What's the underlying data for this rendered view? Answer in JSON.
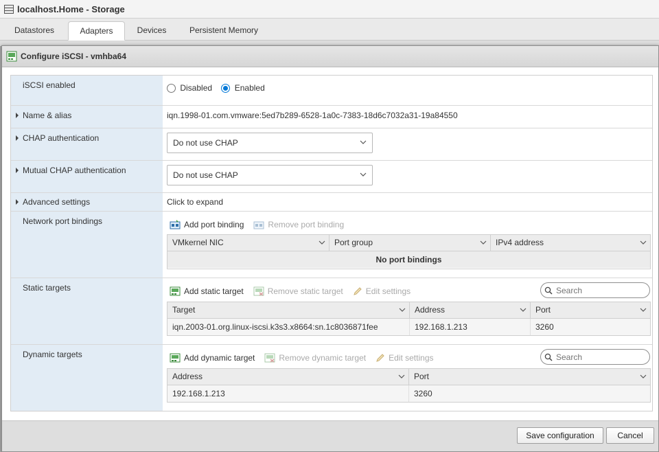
{
  "app": {
    "title": "localhost.Home - Storage"
  },
  "tabs": [
    {
      "label": "Datastores"
    },
    {
      "label": "Adapters",
      "active": true
    },
    {
      "label": "Devices"
    },
    {
      "label": "Persistent Memory"
    }
  ],
  "dialog": {
    "title": "Configure iSCSI - vmhba64",
    "iscsi_enabled": {
      "label": "iSCSI enabled",
      "options": [
        "Disabled",
        "Enabled"
      ],
      "selected": "Enabled"
    },
    "name_alias": {
      "label": "Name & alias",
      "value": "iqn.1998-01.com.vmware:5ed7b289-6528-1a0c-7383-18d6c7032a31-19a84550"
    },
    "chap": {
      "label": "CHAP authentication",
      "value": "Do not use CHAP"
    },
    "mutual_chap": {
      "label": "Mutual CHAP authentication",
      "value": "Do not use CHAP"
    },
    "advanced": {
      "label": "Advanced settings",
      "value": "Click to expand"
    },
    "port_bindings": {
      "label": "Network port bindings",
      "add": "Add port binding",
      "remove": "Remove port binding",
      "columns": [
        "VMkernel NIC",
        "Port group",
        "IPv4 address"
      ],
      "empty": "No port bindings"
    },
    "static_targets": {
      "label": "Static targets",
      "add": "Add static target",
      "remove": "Remove static target",
      "edit": "Edit settings",
      "search_placeholder": "Search",
      "columns": [
        "Target",
        "Address",
        "Port"
      ],
      "rows": [
        {
          "target": "iqn.2003-01.org.linux-iscsi.k3s3.x8664:sn.1c8036871fee",
          "address": "192.168.1.213",
          "port": "3260"
        }
      ]
    },
    "dynamic_targets": {
      "label": "Dynamic targets",
      "add": "Add dynamic target",
      "remove": "Remove dynamic target",
      "edit": "Edit settings",
      "search_placeholder": "Search",
      "columns": [
        "Address",
        "Port"
      ],
      "rows": [
        {
          "address": "192.168.1.213",
          "port": "3260"
        }
      ]
    },
    "buttons": {
      "save": "Save configuration",
      "cancel": "Cancel"
    }
  }
}
